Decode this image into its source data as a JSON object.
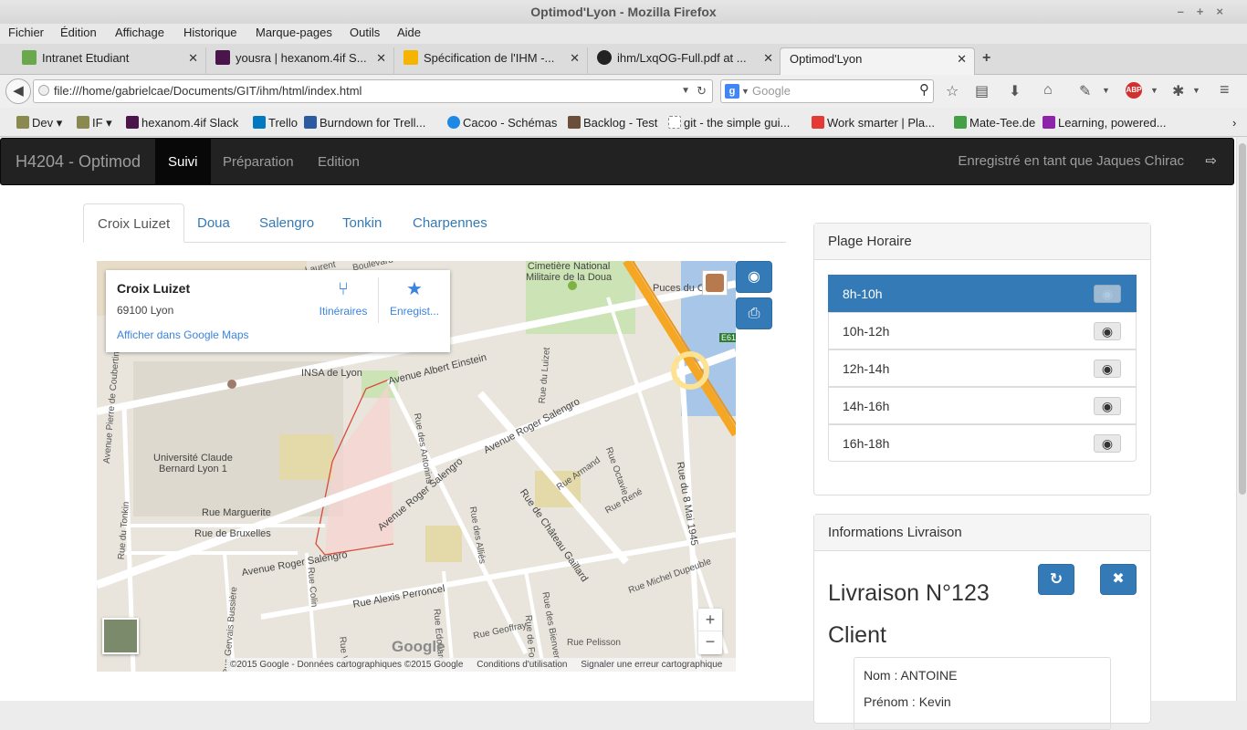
{
  "window": {
    "title": "Optimod'Lyon - Mozilla Firefox"
  },
  "menu": [
    "Fichier",
    "Édition",
    "Affichage",
    "Historique",
    "Marque-pages",
    "Outils",
    "Aide"
  ],
  "tabs": [
    {
      "label": "Intranet Etudiant",
      "color": "#6aa84f"
    },
    {
      "label": "yousra | hexanom.4if S...",
      "color": "#4a154b"
    },
    {
      "label": "Spécification de l'IHM -...",
      "color": "#f4b400"
    },
    {
      "label": "ihm/LxqOG-Full.pdf at ...",
      "color": "#222222"
    },
    {
      "label": "Optimod'Lyon",
      "color": ""
    }
  ],
  "url": "file:///home/gabrielcae/Documents/GIT/ihm/html/index.html",
  "search_placeholder": "Google",
  "bookmarks": [
    {
      "label": "Dev",
      "color": "#8a8a50"
    },
    {
      "label": "IF",
      "color": "#8a8a50"
    },
    {
      "label": "hexanom.4if Slack",
      "color": "#4a154b"
    },
    {
      "label": "Trello",
      "color": "#0079bf"
    },
    {
      "label": "Burndown for Trell...",
      "color": "#2c5aa0"
    },
    {
      "label": "Cacoo - Schémas",
      "color": "#1e88e5"
    },
    {
      "label": "Backlog - Test",
      "color": "#6b4f3a"
    },
    {
      "label": "git - the simple gui...",
      "color": "#ffffff"
    },
    {
      "label": "Work smarter | Pla...",
      "color": "#e53935"
    },
    {
      "label": "Mate-Tee.de",
      "color": "#43a047"
    },
    {
      "label": "Learning, powered...",
      "color": "#8e24aa"
    }
  ],
  "app": {
    "brand": "H4204 - Optimod",
    "nav": [
      "Suivi",
      "Préparation",
      "Edition"
    ],
    "user_text": "Enregistré en tant que Jaques Chirac"
  },
  "place_tabs": [
    "Croix Luizet",
    "Doua",
    "Salengro",
    "Tonkin",
    "Charpennes"
  ],
  "map": {
    "card_title": "Croix Luizet",
    "card_address": "69100 Lyon",
    "card_link": "Afficher dans Google Maps",
    "itineraires": "Itinéraires",
    "enregistrer": "Enregist...",
    "footer": "©2015 Google - Données cartographiques ©2015 Google",
    "terms": "Conditions d'utilisation",
    "report": "Signaler une erreur cartographique",
    "logo": "Google",
    "labels": {
      "l1": "INSA de Lyon",
      "l2": "Université Claude\nBernard Lyon 1",
      "l3": "Avenue Albert Einstein",
      "l4": "Avenue Roger Salengro",
      "l5": "Avenue Roger Salengro",
      "l6": "Rue Alexis Perroncel",
      "l7": "Rue de Château Gaillard",
      "l8": "Rue du 8 Mai 1945",
      "l9": "Rue Marguerite",
      "l10": "Rue de Bruxelles",
      "l11": "Cimetière National\nMilitaire de la Doua",
      "l12": "Puces du C",
      "l13": "Rue des Antonins",
      "l14": "Rue Armand",
      "l15": "Rue René",
      "l16": "Rue Michel Dupeuble",
      "l17": "Rue Geoffray",
      "l18": "Rue Pelisson",
      "l19": "Avenue Pierre de Coubertin",
      "l20": "Rue du Tonkin",
      "l21": "E61",
      "l22": "Rue du Luizet",
      "l23": "Rue Octavie",
      "l24": "Rue Colin",
      "l25": "Rue des Alliés",
      "l26": "Rue Edouard",
      "l27": "Rue des Bienvenus",
      "l28": "Avenue Roger Salengro",
      "l29": "Rue Gervais Bussière",
      "l30": "Rue de Font",
      "l31": "Boulevard",
      "l32": "Laurent",
      "l33": "Rue V"
    }
  },
  "plage": {
    "title": "Plage Horaire",
    "slots": [
      "8h-10h",
      "10h-12h",
      "12h-14h",
      "14h-16h",
      "16h-18h"
    ]
  },
  "livraison": {
    "title": "Informations Livraison",
    "number": "Livraison N°123",
    "client_heading": "Client",
    "nom": "Nom : ANTOINE",
    "prenom": "Prénom : Kevin"
  }
}
